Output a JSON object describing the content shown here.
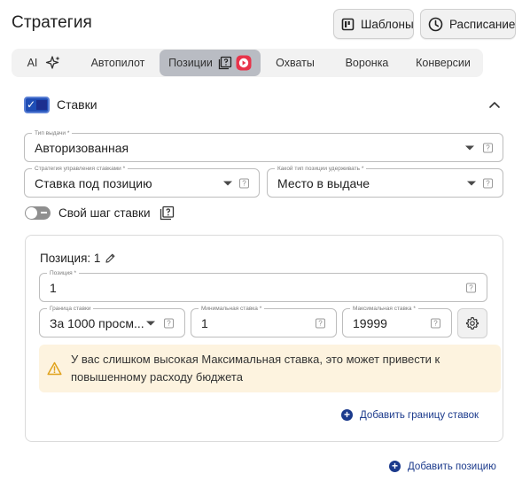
{
  "header": {
    "title": "Стратегия",
    "templates_label": "Шаблоны",
    "schedule_label": "Расписание"
  },
  "tabs": [
    {
      "label": "AI",
      "active": false
    },
    {
      "label": "Автопилот",
      "active": false
    },
    {
      "label": "Позиции",
      "active": true
    },
    {
      "label": "Охваты",
      "active": false
    },
    {
      "label": "Воронка",
      "active": false
    },
    {
      "label": "Конверсии",
      "active": false
    }
  ],
  "bids": {
    "section_label": "Ставки",
    "section_checked": true,
    "delivery_type": {
      "label": "Тип выдачи *",
      "value": "Авторизованная"
    },
    "bid_strategy": {
      "label": "Стратегия управления ставками *",
      "value": "Ставка под позицию"
    },
    "position_type": {
      "label": "Какой тип позиции удерживать *",
      "value": "Место в выдаче"
    },
    "own_step": {
      "label": "Свой шаг ставки",
      "enabled": false
    }
  },
  "position_card": {
    "title": "Позиция: 1",
    "position_field": {
      "label": "Позиция *",
      "value": "1"
    },
    "bid_limit": {
      "label": "Граница ставки",
      "value": "За 1000 просм..."
    },
    "min_bid": {
      "label": "Минимальная ставка *",
      "value": "1"
    },
    "max_bid": {
      "label": "Максимальная ставка *",
      "value": "19999"
    },
    "warning": "У вас слишком высокая Максимальная ставка, это может привести к повышенному расходу бюджета",
    "add_limit_label": "Добавить границу ставок"
  },
  "add_position_label": "Добавить позицию",
  "colors": {
    "accent": "#1f4db5",
    "link": "#1b3a8c",
    "warning_bg": "#fdf3df",
    "warning_icon": "#e0a21c",
    "badge_red": "#e8334a"
  }
}
